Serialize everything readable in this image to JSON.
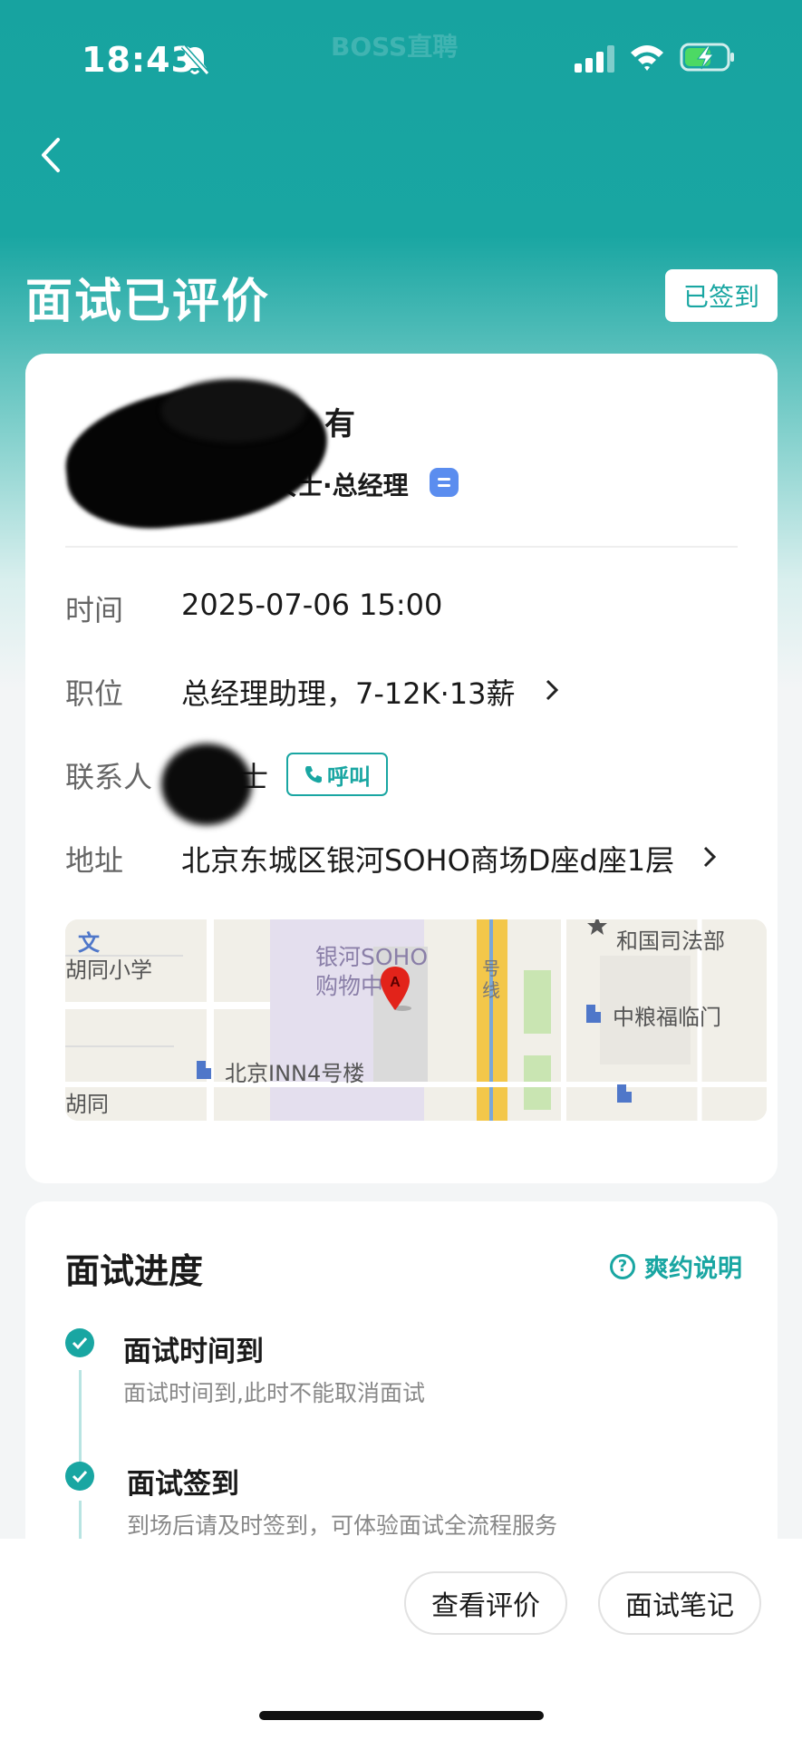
{
  "status_bar": {
    "time": "18:43",
    "watermark": "BOSS直聘"
  },
  "header": {
    "title": "面试已评价",
    "badge": "已签到"
  },
  "interview": {
    "company": "有",
    "contact_person": "姚女士·总经理",
    "rows": {
      "time_label": "时间",
      "time_value": "2025-07-06 15:00",
      "position_label": "职位",
      "position_value": "总经理助理，7-12K·13薪",
      "contact_label": "联系人",
      "contact_value": "姚女士",
      "call_label": "呼叫",
      "address_label": "地址",
      "address_value": "北京东城区银河SOHO商场D座d座1层"
    },
    "map_labels": {
      "l1": "文",
      "l2": "胡同小学",
      "l3": "银河SOHO",
      "l4": "购物中",
      "l5": "号",
      "l6": "线",
      "l7": "和国司法部",
      "l8": "中粮福临门",
      "l9": "北京INN4号楼",
      "l10": "胡同",
      "marker": "A"
    }
  },
  "progress": {
    "title": "面试进度",
    "explain": "爽约说明",
    "steps": [
      {
        "title": "面试时间到",
        "desc": "面试时间到,此时不能取消面试"
      },
      {
        "title": "面试签到",
        "desc": "到场后请及时签到，可体验面试全流程服务"
      }
    ]
  },
  "actions": {
    "view_review": "查看评价",
    "notes": "面试笔记"
  },
  "colors": {
    "accent": "#19a6a2",
    "header_bg": "#17a3a0"
  }
}
